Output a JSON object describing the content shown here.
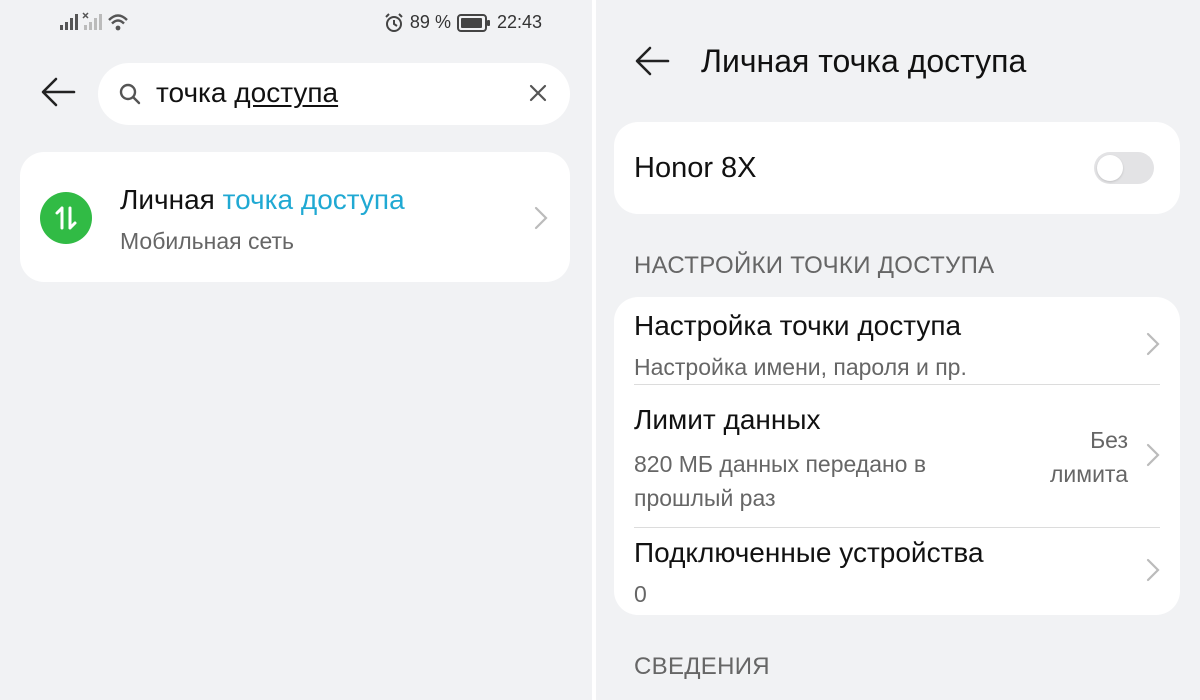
{
  "status_bar": {
    "battery_percent": "89 %",
    "time": "22:43",
    "icons": [
      "signal-icon",
      "signal-crossed-icon",
      "wifi-icon",
      "alarm-icon",
      "battery-icon"
    ]
  },
  "search_panel": {
    "query_part1": "точка ",
    "query_part2": "доступа",
    "result": {
      "title_plain": "Личная ",
      "title_highlight": "точка доступа",
      "subtitle": "Мобильная сеть",
      "icon": "hotspot-arrows-icon"
    }
  },
  "hotspot_panel": {
    "title": "Личная точка доступа",
    "device_name": "Honor 8X",
    "toggle_on": false,
    "section_settings": "НАСТРОЙКИ ТОЧКИ ДОСТУПА",
    "rows": [
      {
        "title": "Настройка точки доступа",
        "subtitle": "Настройка имени, пароля и пр."
      },
      {
        "title": "Лимит данных",
        "subtitle_line1": "820 МБ данных передано в",
        "subtitle_line2": "прошлый раз",
        "value_line1": "Без",
        "value_line2": "лимита"
      },
      {
        "title": "Подключенные устройства",
        "subtitle": "0"
      }
    ],
    "section_info": "СВЕДЕНИЯ"
  },
  "colors": {
    "background": "#f1f2f4",
    "card": "#ffffff",
    "highlight": "#20a9d3",
    "hotspot_icon_bg": "#31bb45"
  }
}
